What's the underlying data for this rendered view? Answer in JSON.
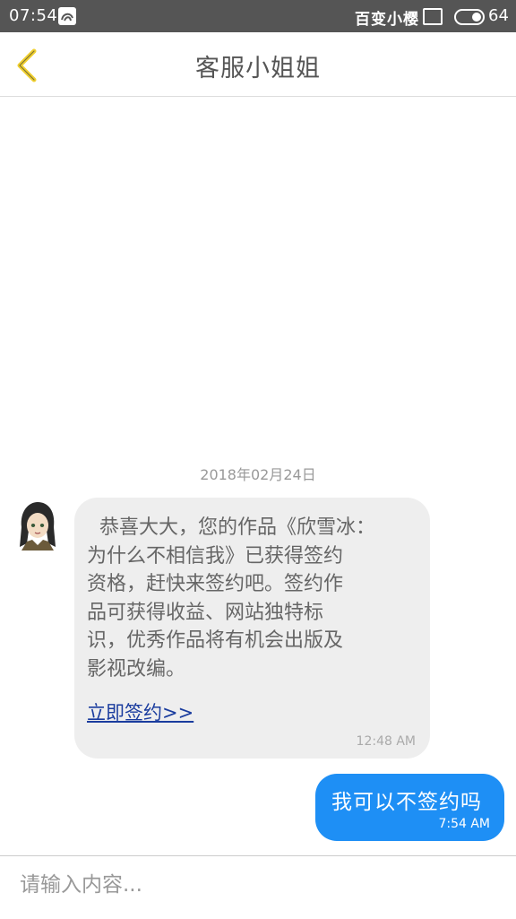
{
  "status_bar": {
    "time": "07:54",
    "carrier": "百变小樱",
    "battery": "64"
  },
  "header": {
    "title": "客服小姐姐"
  },
  "chat": {
    "date": "2018年02月24日",
    "incoming": {
      "text": "  恭喜大大，您的作品《欣雪冰：\n为什么不相信我》已获得签约\n资格，赶快来签约吧。签约作\n品可获得收益、网站独特标\n识，优秀作品将有机会出版及\n影视改编。",
      "link": "立即签约>> ",
      "time": "12:48 AM"
    },
    "outgoing": {
      "text": "我可以不签约吗",
      "time": "7:54 AM"
    }
  },
  "input": {
    "placeholder": "请输入内容...",
    "value": ""
  },
  "colors": {
    "status_bar": "#555555",
    "accent_yellow": "#f0d030",
    "outgoing_bubble": "#1e8ff5",
    "incoming_bubble": "#eeeeee",
    "link": "#1a3c9e"
  }
}
